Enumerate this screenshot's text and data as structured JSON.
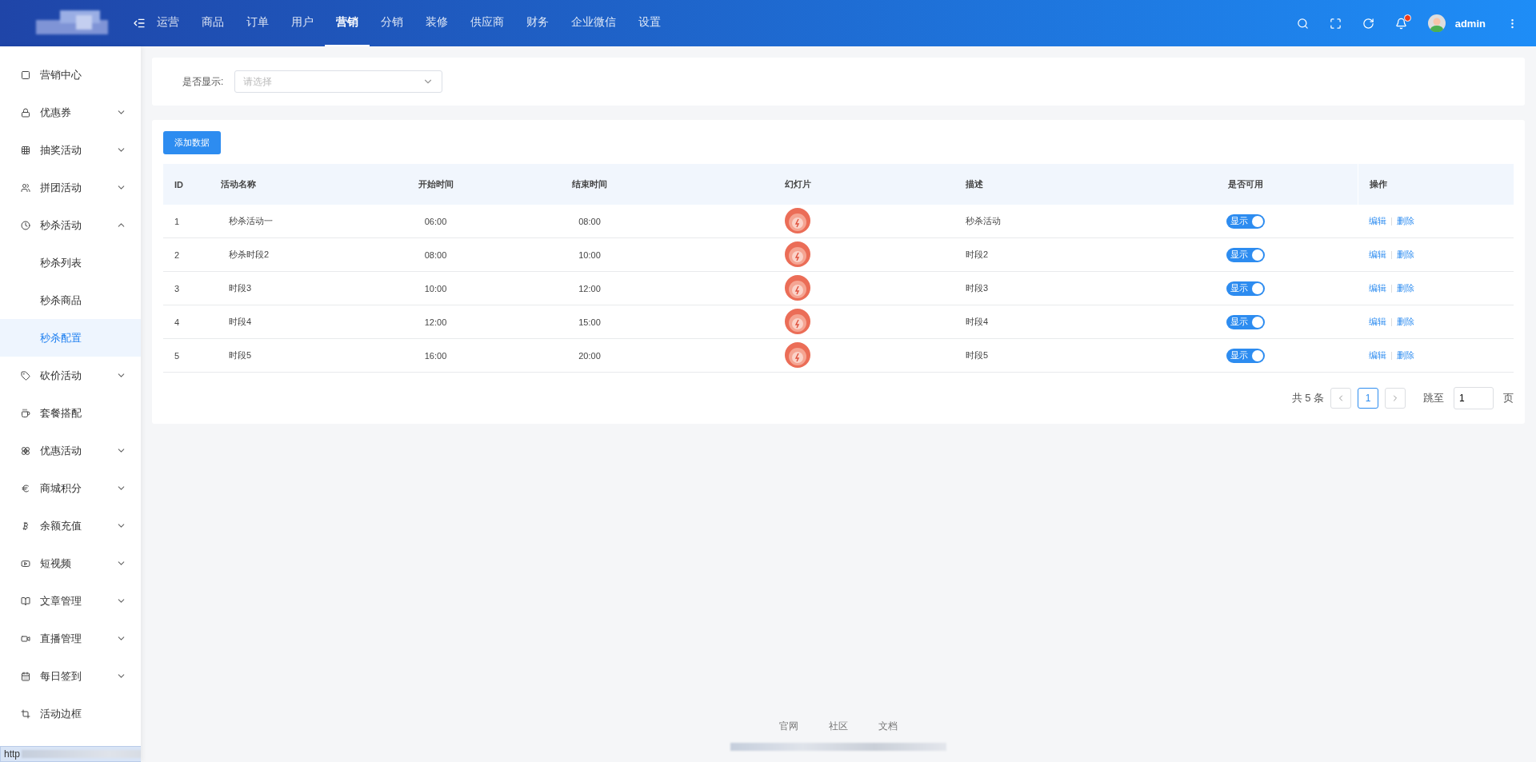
{
  "topbar": {
    "nav": [
      {
        "label": "运营",
        "selected": false
      },
      {
        "label": "商品",
        "selected": false
      },
      {
        "label": "订单",
        "selected": false
      },
      {
        "label": "用户",
        "selected": false
      },
      {
        "label": "营销",
        "selected": true
      },
      {
        "label": "分销",
        "selected": false
      },
      {
        "label": "装修",
        "selected": false
      },
      {
        "label": "供应商",
        "selected": false
      },
      {
        "label": "财务",
        "selected": false
      },
      {
        "label": "企业微信",
        "selected": false
      },
      {
        "label": "设置",
        "selected": false
      }
    ],
    "notification_dot": true,
    "user": "admin"
  },
  "sidebar": {
    "items": [
      {
        "label": "营销中心"
      },
      {
        "label": "优惠券",
        "expanded": false
      },
      {
        "label": "抽奖活动",
        "expanded": false
      },
      {
        "label": "拼团活动",
        "expanded": false
      },
      {
        "label": "秒杀活动",
        "expanded": true,
        "children": [
          {
            "label": "秒杀列表",
            "selected": false
          },
          {
            "label": "秒杀商品",
            "selected": false
          },
          {
            "label": "秒杀配置",
            "selected": true
          }
        ]
      },
      {
        "label": "砍价活动",
        "expanded": false
      },
      {
        "label": "套餐搭配"
      },
      {
        "label": "优惠活动",
        "expanded": false
      },
      {
        "label": "商城积分",
        "expanded": false
      },
      {
        "label": "余额充值",
        "expanded": false
      },
      {
        "label": "短视频",
        "expanded": false
      },
      {
        "label": "文章管理",
        "expanded": false
      },
      {
        "label": "直播管理",
        "expanded": false
      },
      {
        "label": "每日签到",
        "expanded": false
      },
      {
        "label": "活动边框"
      }
    ]
  },
  "filter": {
    "label": "是否显示:",
    "placeholder": "请选择"
  },
  "add_button": "添加数据",
  "table": {
    "columns": [
      "ID",
      "活动名称",
      "开始时间",
      "结束时间",
      "幻灯片",
      "描述",
      "是否可用",
      "操作"
    ],
    "rows": [
      {
        "id": "1",
        "name": "秒杀活动一",
        "start": "06:00",
        "end": "08:00",
        "description": "秒杀活动",
        "toggle_label": "显示",
        "on": true,
        "actions": [
          "编辑",
          "删除"
        ]
      },
      {
        "id": "2",
        "name": "秒杀时段2",
        "start": "08:00",
        "end": "10:00",
        "description": "时段2",
        "toggle_label": "显示",
        "on": true,
        "actions": [
          "编辑",
          "删除"
        ]
      },
      {
        "id": "3",
        "name": "时段3",
        "start": "10:00",
        "end": "12:00",
        "description": "时段3",
        "toggle_label": "显示",
        "on": true,
        "actions": [
          "编辑",
          "删除"
        ]
      },
      {
        "id": "4",
        "name": "时段4",
        "start": "12:00",
        "end": "15:00",
        "description": "时段4",
        "toggle_label": "显示",
        "on": true,
        "actions": [
          "编辑",
          "删除"
        ]
      },
      {
        "id": "5",
        "name": "时段5",
        "start": "16:00",
        "end": "20:00",
        "description": "时段5",
        "toggle_label": "显示",
        "on": true,
        "actions": [
          "编辑",
          "删除"
        ]
      }
    ]
  },
  "pagination": {
    "total": "共 5 条",
    "pages": [
      {
        "label": "1",
        "selected": true
      }
    ],
    "jump_label": "跳至",
    "jump_value": "1",
    "page_unit": "页"
  },
  "footer": {
    "links": [
      "官网",
      "社区",
      "文档"
    ]
  },
  "status_bar": {
    "text": "http"
  }
}
